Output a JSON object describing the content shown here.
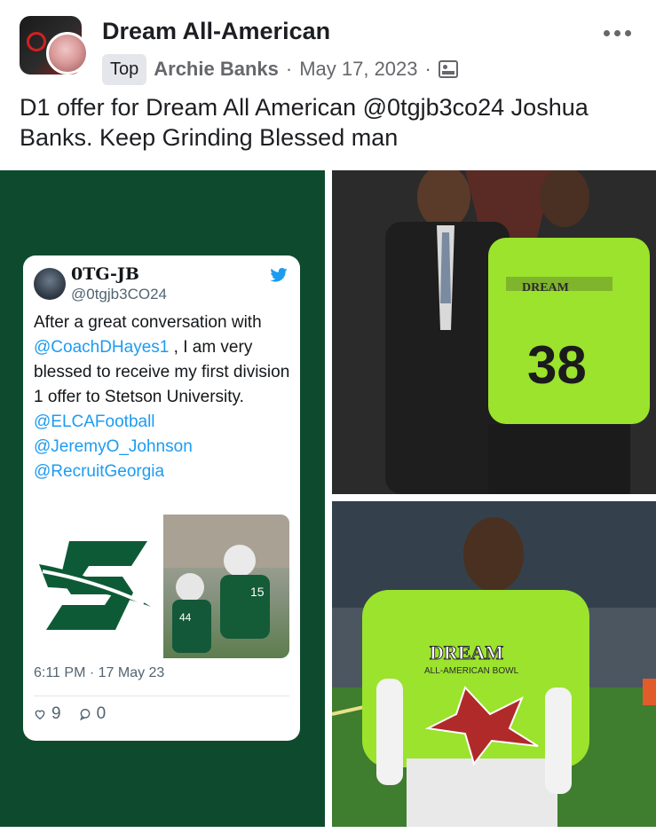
{
  "post": {
    "page_name": "Dream All-American",
    "role_badge": "Top",
    "author": "Archie Banks",
    "separator": "·",
    "date": "May 17, 2023",
    "text": "D1 offer for Dream All American @0tgjb3co24 Joshua Banks.  Keep Grinding Blessed man"
  },
  "icons": {
    "more": "more-options-icon",
    "audience": "audience-icon",
    "twitter": "twitter-bird-icon",
    "like": "heart-icon",
    "reply": "reply-bubble-icon"
  },
  "colors": {
    "panel_green": "#0e4b2e",
    "twitter_blue": "#1d9bf0",
    "jersey_lime": "#9be32d"
  },
  "tweet": {
    "name": "0TG-JB",
    "handle": "@0tgjb3CO24",
    "text_1": "After a great conversation with ",
    "mention_1": "@CoachDHayes1",
    "text_2": " , I am very blessed to receive my first division 1 offer to Stetson University.",
    "mention_2": "@ELCAFootball",
    "mention_3": "@JeremyO_Johnson",
    "mention_4": "@RecruitGeorgia",
    "time": "6:11 PM · 17 May 23",
    "likes": "9",
    "replies": "0"
  },
  "photos": {
    "jersey_text": "DREAM",
    "jersey_subtext": "ALL-AMERICAN BOWL",
    "jersey_number": "38",
    "player_number_1": "15",
    "player_number_2": "44"
  }
}
